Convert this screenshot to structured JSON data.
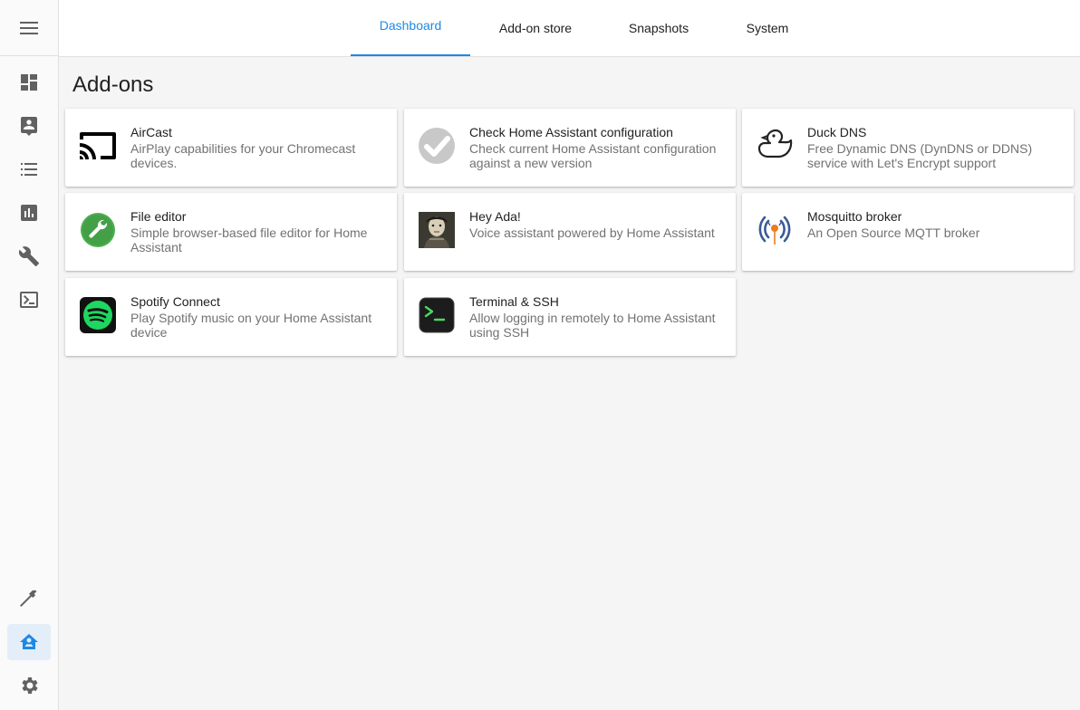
{
  "tabs": [
    {
      "label": "Dashboard"
    },
    {
      "label": "Add-on store"
    },
    {
      "label": "Snapshots"
    },
    {
      "label": "System"
    }
  ],
  "page": {
    "title": "Add-ons"
  },
  "colors": {
    "accent": "#1e88e5",
    "sidebar_bg": "#fafafa",
    "page_bg": "#f5f5f5"
  },
  "sidebar": {
    "items": [
      {
        "icon": "dashboard-icon"
      },
      {
        "icon": "map-icon"
      },
      {
        "icon": "logbook-icon"
      },
      {
        "icon": "history-icon"
      },
      {
        "icon": "configuration-icon"
      },
      {
        "icon": "terminal-icon"
      },
      {
        "icon": "developer-tools-icon"
      },
      {
        "icon": "supervisor-icon"
      },
      {
        "icon": "settings-icon"
      }
    ]
  },
  "addons": [
    {
      "title": "AirCast",
      "desc": "AirPlay capabilities for your Chromecast devices.",
      "icon": "cast-icon"
    },
    {
      "title": "Check Home Assistant configuration",
      "desc": "Check current Home Assistant configuration against a new version",
      "icon": "check-icon"
    },
    {
      "title": "Duck DNS",
      "desc": "Free Dynamic DNS (DynDNS or DDNS) service with Let's Encrypt support",
      "icon": "duck-icon"
    },
    {
      "title": "File editor",
      "desc": "Simple browser-based file editor for Home Assistant",
      "icon": "wrench-icon"
    },
    {
      "title": "Hey Ada!",
      "desc": "Voice assistant powered by Home Assistant",
      "icon": "ada-portrait-icon"
    },
    {
      "title": "Mosquitto broker",
      "desc": "An Open Source MQTT broker",
      "icon": "mosquitto-icon"
    },
    {
      "title": "Spotify Connect",
      "desc": "Play Spotify music on your Home Assistant device",
      "icon": "spotify-icon"
    },
    {
      "title": "Terminal & SSH",
      "desc": "Allow logging in remotely to Home Assistant using SSH",
      "icon": "terminal-app-icon"
    }
  ]
}
